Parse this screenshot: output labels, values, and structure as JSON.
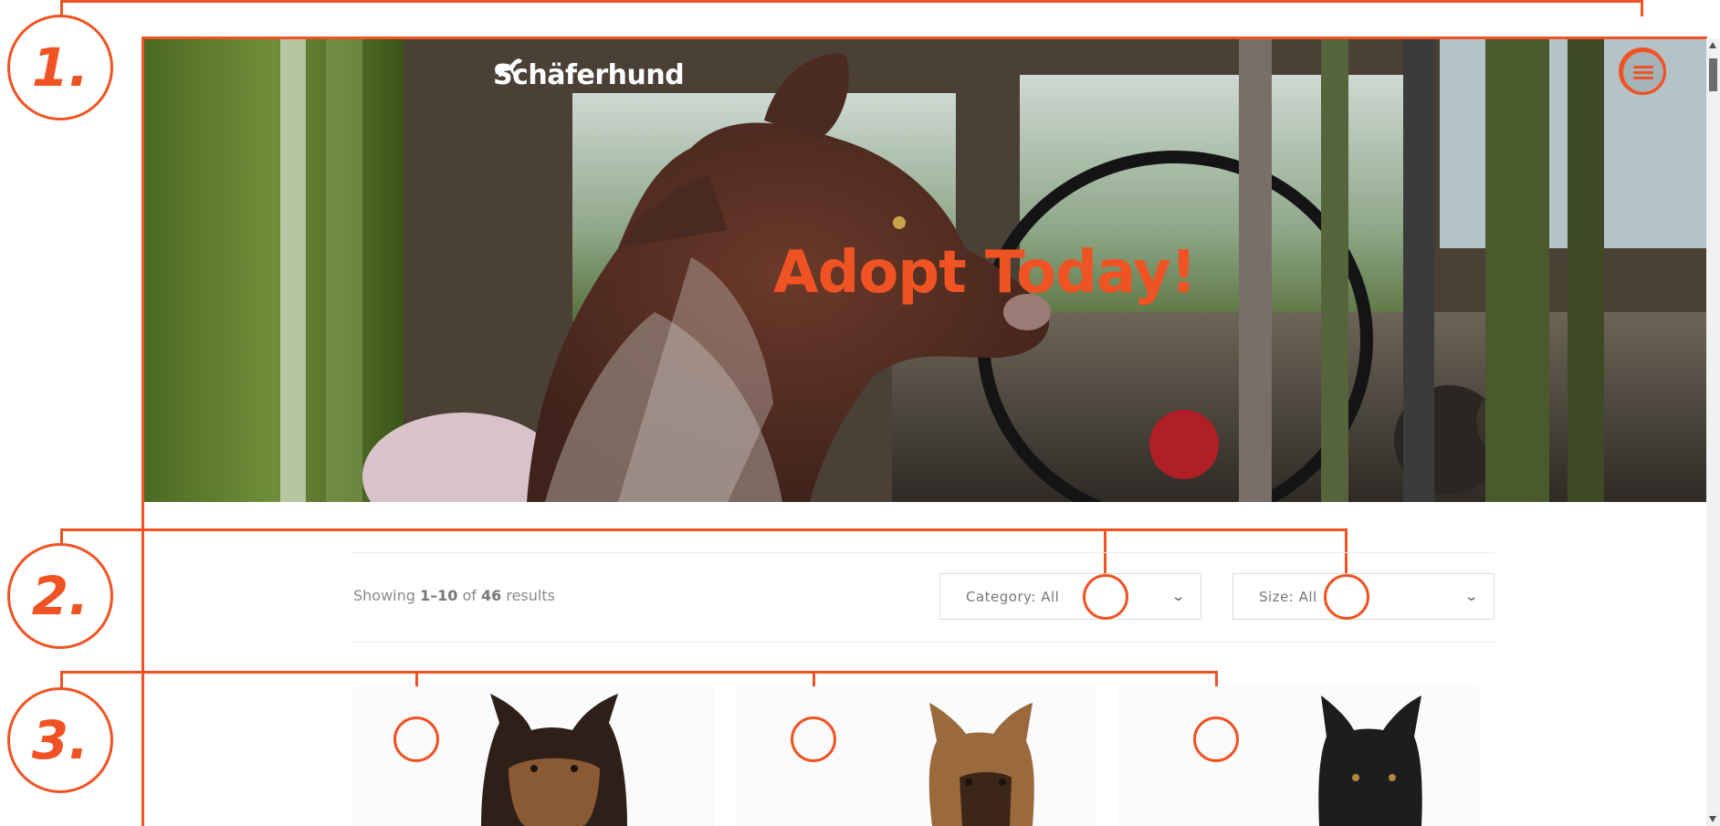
{
  "header": {
    "logo_text": "Schäferhund",
    "logo_icon": "running-dog-icon",
    "menu_icon": "hamburger-menu-icon",
    "hero_title": "Adopt Today!"
  },
  "annotations": {
    "step1": "1.",
    "step2": "2.",
    "step3": "3."
  },
  "filters": {
    "results_prefix": "Showing ",
    "results_range": "1–10",
    "results_of": " of ",
    "results_total": "46",
    "results_suffix": " results",
    "category_label": "Category: All",
    "size_label": "Size: All",
    "dropdown_icon": "chevron-down-icon"
  },
  "products": [
    {
      "image": "brown-german-shepherd"
    },
    {
      "image": "tan-german-shepherd"
    },
    {
      "image": "black-german-shepherd"
    }
  ],
  "colors": {
    "accent": "#f05323",
    "text_muted": "#8a8a8a",
    "border": "#dcdcdc"
  }
}
